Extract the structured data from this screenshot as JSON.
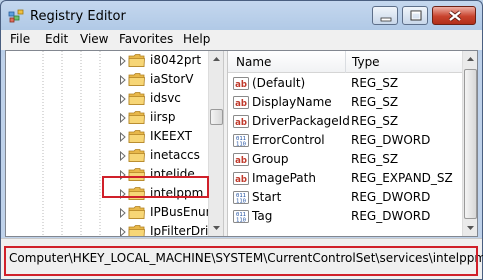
{
  "window": {
    "title": "Registry Editor"
  },
  "icons": {
    "app": "registry-editor-icon",
    "minimize": "minimize-icon",
    "maximize": "maximize-icon",
    "close": "close-icon",
    "folder": "folder-icon",
    "expander": "expander-arrow-icon",
    "string_value": "string-value-icon",
    "binary_value": "dword-value-icon"
  },
  "menu": [
    "File",
    "Edit",
    "View",
    "Favorites",
    "Help"
  ],
  "tree": {
    "items": [
      {
        "label": "i8042prt",
        "selected": false
      },
      {
        "label": "iaStorV",
        "selected": false
      },
      {
        "label": "idsvc",
        "selected": false
      },
      {
        "label": "iirsp",
        "selected": false
      },
      {
        "label": "IKEEXT",
        "selected": false
      },
      {
        "label": "inetaccs",
        "selected": false
      },
      {
        "label": "intelide",
        "selected": false
      },
      {
        "label": "intelppm",
        "selected": true
      },
      {
        "label": "IPBusEnum",
        "selected": false
      },
      {
        "label": "IpFilterDriv",
        "selected": false
      }
    ]
  },
  "list": {
    "columns": [
      "Name",
      "Type"
    ],
    "rows": [
      {
        "name": "(Default)",
        "type": "REG_SZ",
        "kind": "string"
      },
      {
        "name": "DisplayName",
        "type": "REG_SZ",
        "kind": "string"
      },
      {
        "name": "DriverPackageId",
        "type": "REG_SZ",
        "kind": "string"
      },
      {
        "name": "ErrorControl",
        "type": "REG_DWORD",
        "kind": "dword"
      },
      {
        "name": "Group",
        "type": "REG_SZ",
        "kind": "string"
      },
      {
        "name": "ImagePath",
        "type": "REG_EXPAND_SZ",
        "kind": "string"
      },
      {
        "name": "Start",
        "type": "REG_DWORD",
        "kind": "dword"
      },
      {
        "name": "Tag",
        "type": "REG_DWORD",
        "kind": "dword"
      }
    ]
  },
  "status": {
    "path": "Computer\\HKEY_LOCAL_MACHINE\\SYSTEM\\CurrentControlSet\\services\\intelppm"
  },
  "colors": {
    "highlight": "#d0202a",
    "window_frame": "#b0c9e6",
    "menu_bg": "#f0f0f0"
  }
}
